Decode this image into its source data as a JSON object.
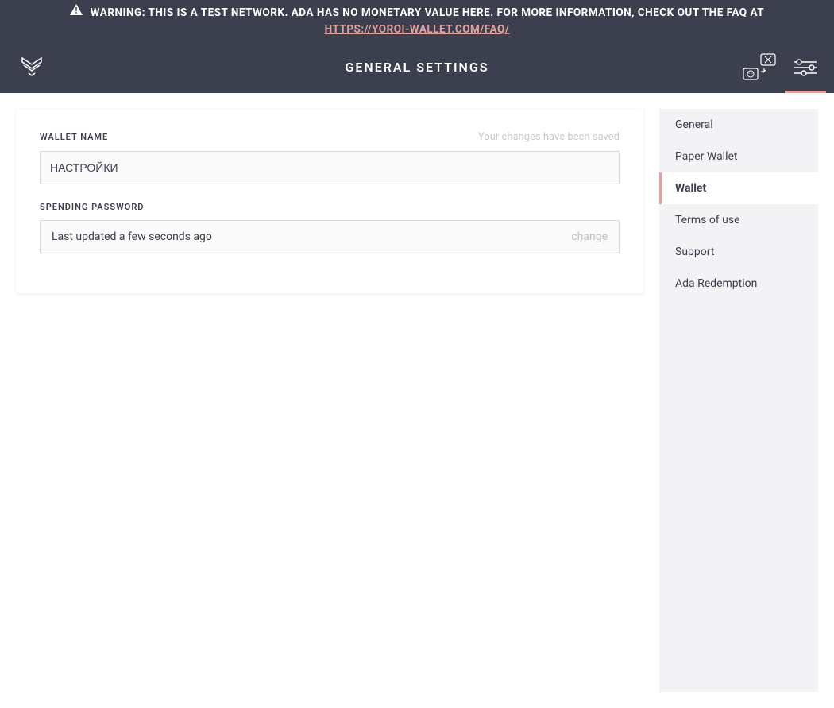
{
  "warning": {
    "text": "WARNING: THIS IS A TEST NETWORK. ADA HAS NO MONETARY VALUE HERE. FOR MORE INFORMATION, CHECK OUT THE FAQ AT",
    "link_text": "HTTPS://YOROI-WALLET.COM/FAQ/"
  },
  "header": {
    "title": "GENERAL SETTINGS"
  },
  "main": {
    "wallet_name": {
      "label": "WALLET NAME",
      "hint": "Your changes have been saved",
      "value": "НАСТРОЙКИ"
    },
    "spending_password": {
      "label": "SPENDING PASSWORD",
      "status": "Last updated a few seconds ago",
      "change_label": "change"
    }
  },
  "sidebar": {
    "items": [
      {
        "label": "General",
        "active": false
      },
      {
        "label": "Paper Wallet",
        "active": false
      },
      {
        "label": "Wallet",
        "active": true
      },
      {
        "label": "Terms of use",
        "active": false
      },
      {
        "label": "Support",
        "active": false
      },
      {
        "label": "Ada Redemption",
        "active": false
      }
    ]
  },
  "colors": {
    "accent": "#e4a09c",
    "dark": "#3c404e"
  }
}
